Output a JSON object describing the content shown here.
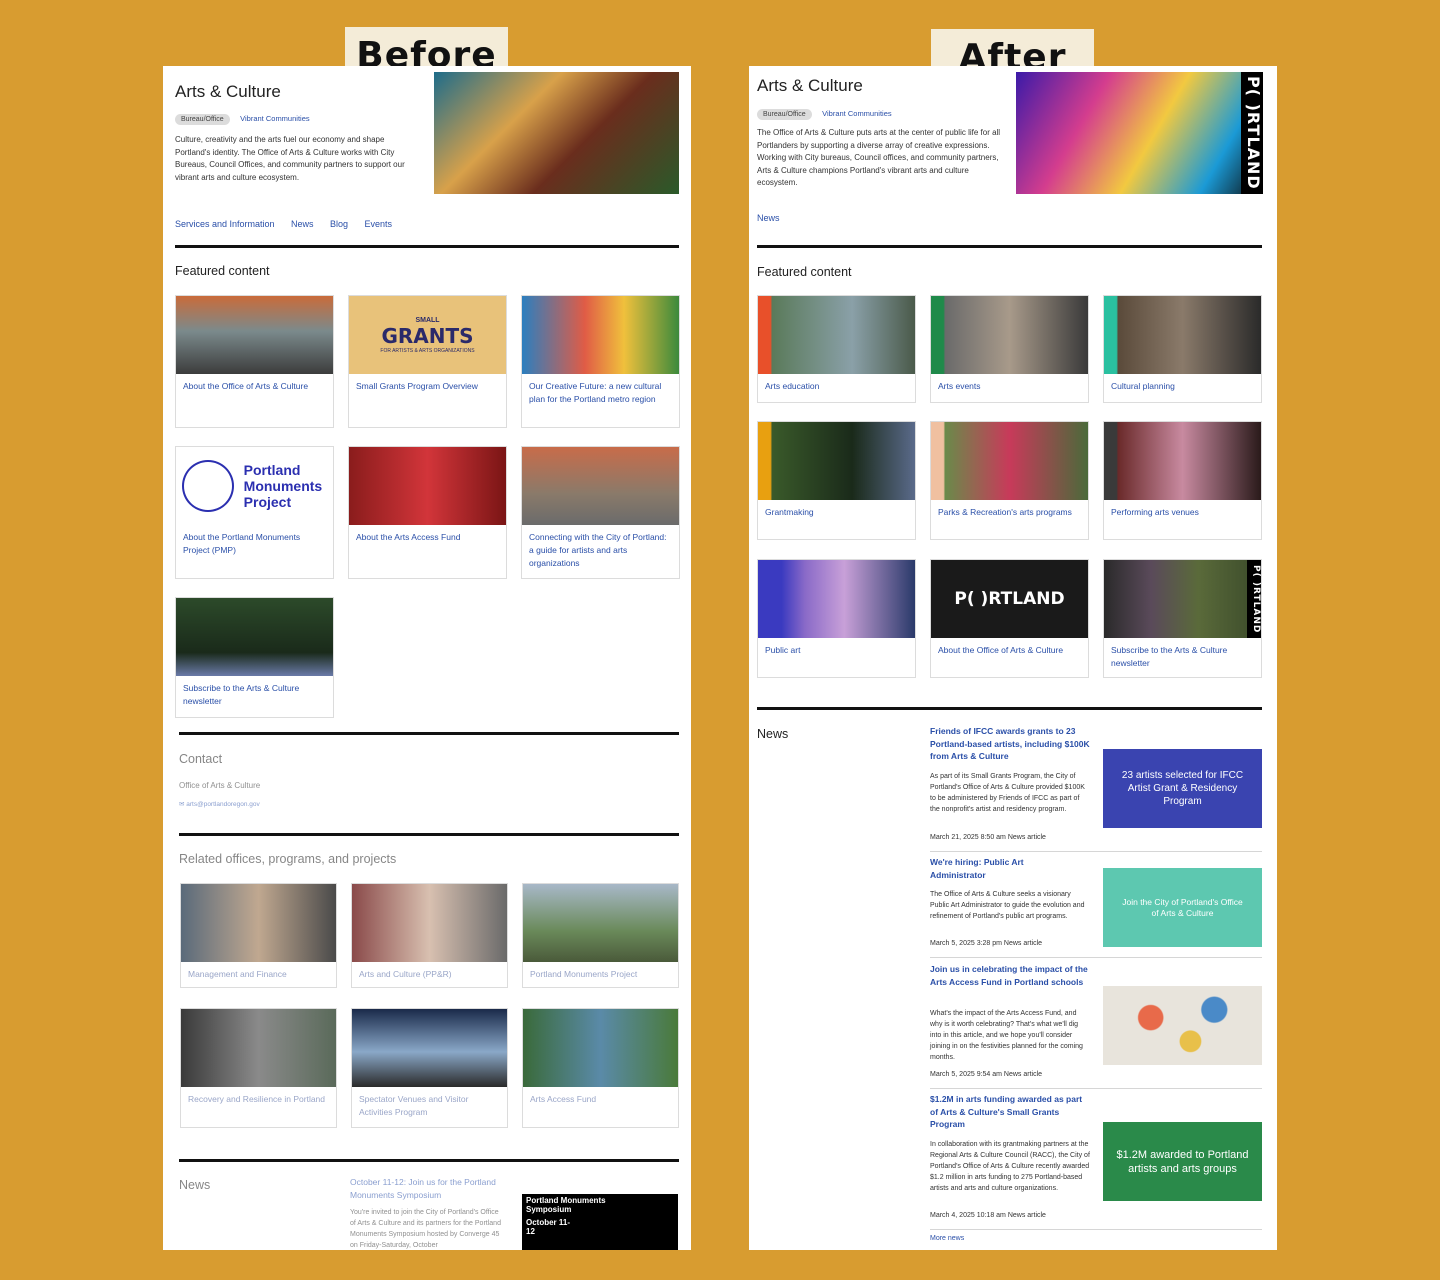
{
  "labels": {
    "before": "Before",
    "after": "After"
  },
  "before": {
    "title": "Arts & Culture",
    "badge": "Bureau/Office",
    "crumb": "Vibrant Communities",
    "description": "Culture, creativity and the arts fuel our economy and shape Portland's identity. The Office of Arts & Culture works with City Bureaus, Council Offices, and community partners to support our vibrant arts and culture ecosystem.",
    "nav": [
      "Services and Information",
      "News",
      "Blog",
      "Events"
    ],
    "featured_heading": "Featured content",
    "featured": [
      "About the Office of Arts & Culture",
      "Small Grants Program Overview",
      "Our Creative Future: a new cultural plan for the Portland metro region",
      "About the Portland Monuments Project (PMP)",
      "About the Arts Access Fund",
      "Connecting with the City of Portland: a guide for artists and arts organizations",
      "Subscribe to the Arts & Culture newsletter"
    ],
    "grants_img": {
      "top": "SMALL",
      "main": "GRANTS",
      "sub": "FOR ARTISTS & ARTS ORGANIZATIONS"
    },
    "pmp_logo": "Portland Monuments Project",
    "contact_heading": "Contact",
    "contact_name": "Office of Arts & Culture",
    "contact_email": "arts@portlandoregon.gov",
    "related_heading": "Related offices, programs, and projects",
    "related": [
      "Management and Finance",
      "Arts and Culture (PP&R)",
      "Portland Monuments Project",
      "Recovery and Resilience in Portland",
      "Spectator Venues and Visitor Activities Program",
      "Arts Access Fund"
    ],
    "news_heading": "News",
    "news_title": "October 11-12: Join us for the Portland Monuments Symposium",
    "news_body": "You're invited to join the City of Portland's Office of Arts & Culture and its partners for the Portland Monuments Symposium hosted by Converge 45 on Friday-Saturday, October",
    "news_img_title": "Portland Monuments Symposium",
    "news_img_date": "October 11-12"
  },
  "after": {
    "title": "Arts & Culture",
    "badge": "Bureau/Office",
    "crumb": "Vibrant Communities",
    "description": "The Office of Arts & Culture puts arts at the center of public life for all Portlanders by supporting a diverse array of creative expressions. Working with City bureaus, Council offices, and community partners, Arts & Culture champions Portland's vibrant arts and culture ecosystem.",
    "nav": [
      "News"
    ],
    "featured_heading": "Featured content",
    "featured": [
      "Arts education",
      "Arts events",
      "Cultural planning",
      "Grantmaking",
      "Parks & Recreation's arts programs",
      "Performing arts venues",
      "Public art",
      "About the Office of Arts & Culture",
      "Subscribe to the Arts & Culture newsletter"
    ],
    "portland_logo": "P(  )RTLAND",
    "news_heading": "News",
    "news": [
      {
        "title": "Friends of IFCC awards grants to 23 Portland-based artists, including $100K from Arts & Culture",
        "body": "As part of its Small Grants Program, the City of Portland's Office of Arts & Culture provided $100K to be administered by Friends of IFCC as part of the nonprofit's artist and residency program.",
        "meta": "March 21, 2025 8:50 am   News article",
        "img_text": "23 artists selected for IFCC Artist Grant & Residency Program"
      },
      {
        "title": "We're hiring: Public Art Administrator",
        "body": "The Office of Arts & Culture seeks a visionary Public Art Administrator to guide the evolution and refinement of Portland's public art programs.",
        "meta": "March 5, 2025 3:28 pm   News article",
        "img_text": "Join the City of Portland's Office of Arts & Culture"
      },
      {
        "title": "Join us in celebrating the impact of the Arts Access Fund in Portland schools",
        "body": "What's the impact of the Arts Access Fund, and why is it worth celebrating? That's what we'll dig into in this article, and we hope you'll consider joining in on the festivities planned for the coming months.",
        "meta": "March 5, 2025 9:54 am   News article",
        "img_text": ""
      },
      {
        "title": "$1.2M in arts funding awarded as part of Arts & Culture's Small Grants Program",
        "body": "In collaboration with its grantmaking partners at the Regional Arts & Culture Council (RACC), the City of Portland's Office of Arts & Culture recently awarded $1.2 million in arts funding to 275 Portland-based artists and arts and culture organizations.",
        "meta": "March 4, 2025 10:18 am   News article",
        "img_text": "$1.2M awarded to Portland artists and arts groups"
      }
    ],
    "more_news": "More news"
  }
}
